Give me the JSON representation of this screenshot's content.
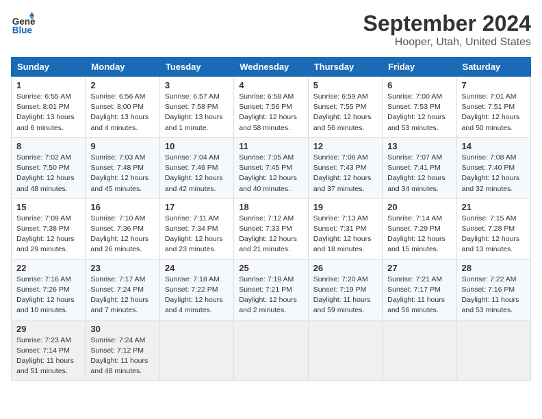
{
  "header": {
    "logo_line1": "General",
    "logo_line2": "Blue",
    "title": "September 2024",
    "subtitle": "Hooper, Utah, United States"
  },
  "days_of_week": [
    "Sunday",
    "Monday",
    "Tuesday",
    "Wednesday",
    "Thursday",
    "Friday",
    "Saturday"
  ],
  "weeks": [
    [
      {
        "day": 1,
        "sunrise": "6:55 AM",
        "sunset": "8:01 PM",
        "daylight": "13 hours and 6 minutes."
      },
      {
        "day": 2,
        "sunrise": "6:56 AM",
        "sunset": "8:00 PM",
        "daylight": "13 hours and 4 minutes."
      },
      {
        "day": 3,
        "sunrise": "6:57 AM",
        "sunset": "7:58 PM",
        "daylight": "13 hours and 1 minute."
      },
      {
        "day": 4,
        "sunrise": "6:58 AM",
        "sunset": "7:56 PM",
        "daylight": "12 hours and 58 minutes."
      },
      {
        "day": 5,
        "sunrise": "6:59 AM",
        "sunset": "7:55 PM",
        "daylight": "12 hours and 56 minutes."
      },
      {
        "day": 6,
        "sunrise": "7:00 AM",
        "sunset": "7:53 PM",
        "daylight": "12 hours and 53 minutes."
      },
      {
        "day": 7,
        "sunrise": "7:01 AM",
        "sunset": "7:51 PM",
        "daylight": "12 hours and 50 minutes."
      }
    ],
    [
      {
        "day": 8,
        "sunrise": "7:02 AM",
        "sunset": "7:50 PM",
        "daylight": "12 hours and 48 minutes."
      },
      {
        "day": 9,
        "sunrise": "7:03 AM",
        "sunset": "7:48 PM",
        "daylight": "12 hours and 45 minutes."
      },
      {
        "day": 10,
        "sunrise": "7:04 AM",
        "sunset": "7:46 PM",
        "daylight": "12 hours and 42 minutes."
      },
      {
        "day": 11,
        "sunrise": "7:05 AM",
        "sunset": "7:45 PM",
        "daylight": "12 hours and 40 minutes."
      },
      {
        "day": 12,
        "sunrise": "7:06 AM",
        "sunset": "7:43 PM",
        "daylight": "12 hours and 37 minutes."
      },
      {
        "day": 13,
        "sunrise": "7:07 AM",
        "sunset": "7:41 PM",
        "daylight": "12 hours and 34 minutes."
      },
      {
        "day": 14,
        "sunrise": "7:08 AM",
        "sunset": "7:40 PM",
        "daylight": "12 hours and 32 minutes."
      }
    ],
    [
      {
        "day": 15,
        "sunrise": "7:09 AM",
        "sunset": "7:38 PM",
        "daylight": "12 hours and 29 minutes."
      },
      {
        "day": 16,
        "sunrise": "7:10 AM",
        "sunset": "7:36 PM",
        "daylight": "12 hours and 26 minutes."
      },
      {
        "day": 17,
        "sunrise": "7:11 AM",
        "sunset": "7:34 PM",
        "daylight": "12 hours and 23 minutes."
      },
      {
        "day": 18,
        "sunrise": "7:12 AM",
        "sunset": "7:33 PM",
        "daylight": "12 hours and 21 minutes."
      },
      {
        "day": 19,
        "sunrise": "7:13 AM",
        "sunset": "7:31 PM",
        "daylight": "12 hours and 18 minutes."
      },
      {
        "day": 20,
        "sunrise": "7:14 AM",
        "sunset": "7:29 PM",
        "daylight": "12 hours and 15 minutes."
      },
      {
        "day": 21,
        "sunrise": "7:15 AM",
        "sunset": "7:28 PM",
        "daylight": "12 hours and 13 minutes."
      }
    ],
    [
      {
        "day": 22,
        "sunrise": "7:16 AM",
        "sunset": "7:26 PM",
        "daylight": "12 hours and 10 minutes."
      },
      {
        "day": 23,
        "sunrise": "7:17 AM",
        "sunset": "7:24 PM",
        "daylight": "12 hours and 7 minutes."
      },
      {
        "day": 24,
        "sunrise": "7:18 AM",
        "sunset": "7:22 PM",
        "daylight": "12 hours and 4 minutes."
      },
      {
        "day": 25,
        "sunrise": "7:19 AM",
        "sunset": "7:21 PM",
        "daylight": "12 hours and 2 minutes."
      },
      {
        "day": 26,
        "sunrise": "7:20 AM",
        "sunset": "7:19 PM",
        "daylight": "11 hours and 59 minutes."
      },
      {
        "day": 27,
        "sunrise": "7:21 AM",
        "sunset": "7:17 PM",
        "daylight": "11 hours and 56 minutes."
      },
      {
        "day": 28,
        "sunrise": "7:22 AM",
        "sunset": "7:16 PM",
        "daylight": "11 hours and 53 minutes."
      }
    ],
    [
      {
        "day": 29,
        "sunrise": "7:23 AM",
        "sunset": "7:14 PM",
        "daylight": "11 hours and 51 minutes."
      },
      {
        "day": 30,
        "sunrise": "7:24 AM",
        "sunset": "7:12 PM",
        "daylight": "11 hours and 48 minutes."
      },
      null,
      null,
      null,
      null,
      null
    ]
  ]
}
